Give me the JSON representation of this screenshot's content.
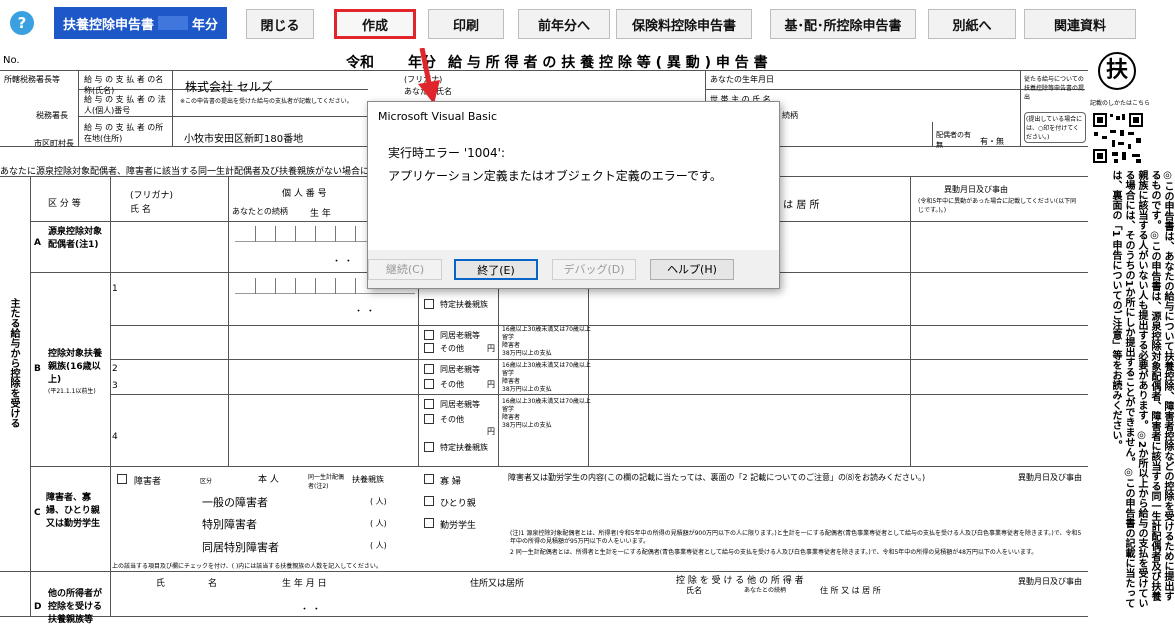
{
  "toolbar": {
    "help_glyph": "?",
    "year_prefix": "扶養控除申告書",
    "year_suffix": "年分",
    "close": "閉じる",
    "create": "作成",
    "print": "印刷",
    "prev_year": "前年分へ",
    "insurance": "保険料控除申告書",
    "basic": "基･配･所控除申告書",
    "separate": "別紙へ",
    "related": "関連資料"
  },
  "form": {
    "no_label": "No.",
    "title_era": "令和",
    "title_year": "年分",
    "title": "給 与 所 得 者 の 扶 養 控 除 等 ( 異 動 ) 申 告 書",
    "tax_office": "所轄税務署長等",
    "payer_name_label": "給 与 の 支 払 者 の名称(氏名)",
    "payer_name": "株式会社 セルズ",
    "payer_corp_label": "給 与 の 支 払 者 の 法人(個人)番号",
    "payer_corp_note": "※この申告書の提出を受けた給与の支払者が記載してください。",
    "payer_addr_label": "給 与 の 支 払 者 の所在地(住所)",
    "payer_addr": "小牧市安田区新町180番地",
    "tax_chief": "税務署長",
    "city_chief": "市区町村長",
    "furigana": "(フリガナ)",
    "your_name": "あなたの氏名",
    "birth": "あなたの生年月日",
    "householder": "世 帯 主 の 氏 名",
    "relation": "続柄",
    "spouse_label": "配偶者の有無",
    "spouse_value": "有・無",
    "right_note1": "従たる給与についての扶養控除等申告書の提出",
    "right_note2": "(提出している場合には、○印を付けてください。)",
    "intro": "あなたに源泉控除対象配偶者、障害者に該当する同一生計配偶者及び扶養親族がない場合には、以下の各欄に記入する必要はありません。",
    "col_kubun": "区 分 等",
    "col_furigana": "(フリガナ)",
    "col_shimei": "氏 名",
    "col_kojin": "個 人 番 号",
    "col_zokugara": "あなたとの続柄",
    "col_seinen": "生 年",
    "col_juusho": "又 は 居 所",
    "col_idou": "異動月日及び事由",
    "col_idou_note": "(令和5年中に異動があった場合に記載してください(以下同じです。)。)",
    "a_letter": "A",
    "a_label": "源泉控除対象配偶者(注1)",
    "b_letter": "B",
    "b_label": "控除対象扶養親族(16歳以上)",
    "b_sub": "(平21.1.1以前生)",
    "side_main": "主たる給与から控除を受ける",
    "row_nums": [
      "1",
      "2",
      "3",
      "4"
    ],
    "opt_tokutei": "特定扶養親族",
    "opt_doukyo": "同居老親等",
    "opt_sonota": "その他",
    "yen": "円",
    "opt_right1": "16歳以上30歳未満又は70歳以上",
    "opt_right2": "留学",
    "opt_right3": "障害者",
    "opt_right4": "38万円以上の支払",
    "c_letter": "C",
    "c_label": "障害者、寡婦、ひとり親又は勤労学生",
    "c_shogaisha": "障害者",
    "c_kubun": "区分",
    "c_honnin": "本 人",
    "c_haigusha": "同一生計配偶者(注2)",
    "c_fuyou": "扶養親族",
    "c_ippan": "一般の障害者",
    "c_tokubetsu": "特別障害者",
    "c_doukyo": "同居特別障害者",
    "c_nin": "( 人)",
    "c_kafu": "寡 婦",
    "c_hitori": "ひとり親",
    "c_kinrou": "勤労学生",
    "c_content": "障害者又は勤労学生の内容(この欄の記載に当たっては、裏面の「2 記載についてのご注意」の⑻をお読みください。)",
    "c_check_note": "上の該当する項目及び欄にチェックを付け、( )内には該当する扶養親族の人数を記入してください。",
    "note1": "(注)1 源泉控除対象配偶者とは、所得者(令和5年中の所得の見積額が900万円以下の人に限ります。)と生計を一にする配偶者(青色事業専従者として給与の支払を受ける人及び白色事業専従者を除きます。)で、令和5年中の所得の見積額が95万円以下の人をいいます。",
    "note2": "2 同一生計配偶者とは、所得者と生計を一にする配偶者(青色事業専従者として給与の支払を受ける人及び白色事業専従者を除きます。)で、令和5年中の所得の見積額が48万円以下の人をいいます。",
    "d_letter": "D",
    "d_label": "他の所得者が控除を受ける扶養親族等",
    "d_shi": "氏",
    "d_mei": "名",
    "d_seinen": "生 年 月 日",
    "d_juusho": "住所又は居所",
    "d_koujo": "控 除 を 受 け る 他 の 所 得 者",
    "d_shimei": "氏名",
    "d_zokugara": "あなたとの続柄",
    "d_jusho2": "住 所 又 は 居 所",
    "dot_sep": "・ ・"
  },
  "side": {
    "stamp": "扶",
    "howto": "記載のしかたはこちら",
    "vertical": "◎この申告書は、あなたの給与について扶養控除、障害者控除などの控除を受けるために提出するものです。◎この申告書は、源泉控除対象配偶者、障害者に該当する同一生計配偶者及び扶養親族に該当する人がいない人も提出する必要があります。◎2か所以上から給与の支払を受けている場合には、そのうちの1か所にしか提出することができません。◎この申告書の記載に当たっては、裏面の「1 申告についてのご注意」等をお読みください。"
  },
  "dialog": {
    "title": "Microsoft Visual Basic",
    "error": "実行時エラー '1004':",
    "message": "アプリケーション定義またはオブジェクト定義のエラーです。",
    "continue": "継続(C)",
    "end": "終了(E)",
    "debug": "デバッグ(D)",
    "help": "ヘルプ(H)"
  }
}
